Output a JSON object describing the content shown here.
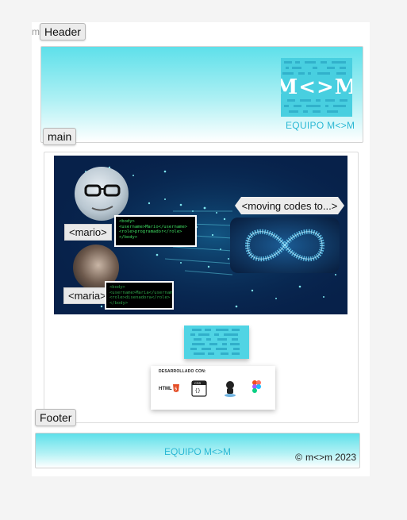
{
  "corner_text": "m",
  "tags": {
    "header": "Header",
    "main": "main",
    "footer": "Footer"
  },
  "header": {
    "logo_text": "M<>M",
    "team_label": "EQUIPO M<>M"
  },
  "banner": {
    "person1_label": "<mario>",
    "person1_code": [
      "<body>",
      "<username>Mario</username>",
      "<role>programador</role>",
      "</body>"
    ],
    "person2_label": "<maria>",
    "person2_code": [
      "<body>",
      "<username>Maria</username>",
      "<role>disenadora</role>",
      "</body>"
    ],
    "bubble_text": "<moving codes to...>"
  },
  "dev_card": {
    "title": "DESARROLLADO CON:",
    "tools": [
      "html5-icon",
      "css3-icon",
      "github-icon",
      "figma-icon"
    ]
  },
  "footer": {
    "team_label": "EQUIPO M<>M",
    "copyright_symbol": "©",
    "copyright_text": "m<>m 2023"
  },
  "colors": {
    "accent_cyan": "#5ee0ea",
    "team_text": "#2bb8d4",
    "banner_bg": "#07214a",
    "code_green": "#3fe063"
  }
}
